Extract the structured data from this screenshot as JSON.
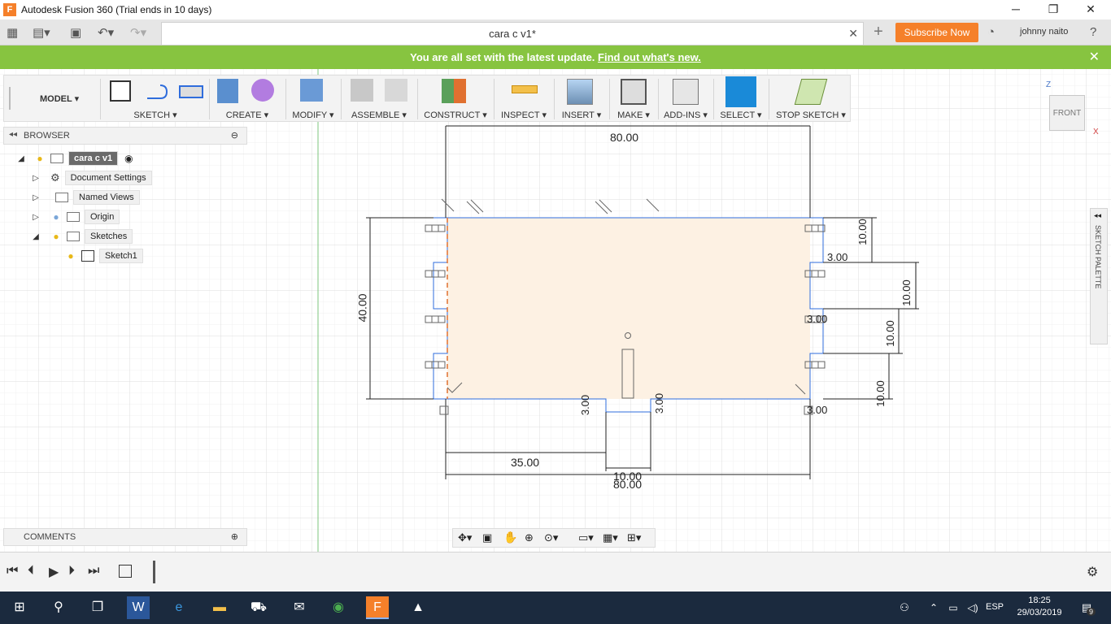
{
  "window": {
    "title": "Autodesk Fusion 360 (Trial ends in 10 days)",
    "logo_letter": "F",
    "minimize_icon": "─",
    "restore_icon": "❐",
    "close_icon": "✕"
  },
  "tabbar": {
    "doc_tab_label": "cara c v1*",
    "close_icon": "✕",
    "new_tab_icon": "+",
    "subscribe_label": "Subscribe Now",
    "user_name": "johnny naito",
    "help_icon": "?"
  },
  "update_bar": {
    "message": "You are all set with the latest update.",
    "link": "Find out what's new.",
    "close_icon": "✕"
  },
  "toolbar": {
    "workspace": "MODEL ▾",
    "groups": [
      {
        "label": "SKETCH ▾"
      },
      {
        "label": "CREATE ▾"
      },
      {
        "label": "MODIFY ▾"
      },
      {
        "label": "ASSEMBLE ▾"
      },
      {
        "label": "CONSTRUCT ▾"
      },
      {
        "label": "INSPECT ▾"
      },
      {
        "label": "INSERT ▾"
      },
      {
        "label": "MAKE ▾"
      },
      {
        "label": "ADD-INS ▾"
      },
      {
        "label": "SELECT ▾"
      },
      {
        "label": "STOP SKETCH ▾"
      }
    ]
  },
  "browser": {
    "title": "BROWSER",
    "items": [
      {
        "label": "cara c v1"
      },
      {
        "label": "Document Settings"
      },
      {
        "label": "Named Views"
      },
      {
        "label": "Origin"
      },
      {
        "label": "Sketches"
      },
      {
        "label": "Sketch1"
      }
    ]
  },
  "comments": {
    "title": "COMMENTS"
  },
  "viewcube": {
    "face": "FRONT",
    "axis_z": "Z",
    "axis_x": "X"
  },
  "palette": {
    "label": "SKETCH PALETTE"
  },
  "sketch": {
    "dimensions": {
      "top_width": "80.00",
      "bottom_width": "80.00",
      "height": "40.00",
      "offset_left": "35.00",
      "slot_width": "10.00",
      "slot_depth_left": "3.00",
      "slot_depth_right": "3.00",
      "right_gap_1": "3.00",
      "right_gap_2": "3.00",
      "right_gap_3": "3.00",
      "right_seg_1": "10.00",
      "right_seg_2": "10.00",
      "right_seg_3": "10.00",
      "right_seg_4": "10.00"
    }
  },
  "taskbar": {
    "language": "ESP",
    "time": "18:25",
    "date": "29/03/2019",
    "notification_count": "9"
  }
}
